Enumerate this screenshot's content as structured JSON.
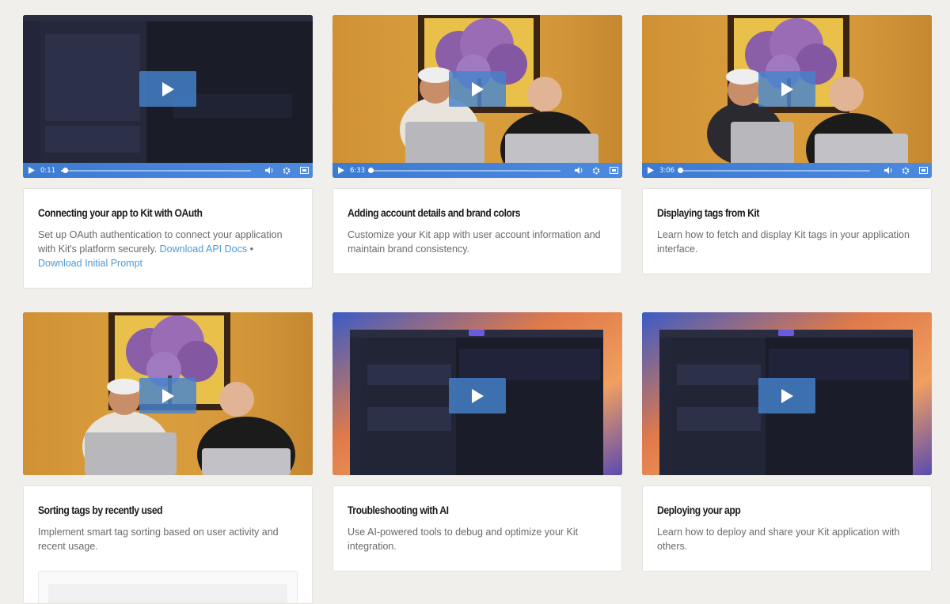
{
  "videos": [
    {
      "title": "Connecting your app to Kit with OAuth",
      "desc": "Set up OAuth authentication to connect your application with Kit's platform securely.",
      "link1": "Download API Docs",
      "sep": "•",
      "link2": "Download Initial Prompt",
      "time": "0:11",
      "progress": 0.02
    },
    {
      "title": "Adding account details and brand colors",
      "desc": "Customize your Kit app with user account information and maintain brand consistency.",
      "time": "6:33",
      "progress": 0.0
    },
    {
      "title": "Displaying tags from Kit",
      "desc": "Learn how to fetch and display Kit tags in your application interface.",
      "time": "3:06",
      "progress": 0.0
    },
    {
      "title": "Sorting tags by recently used",
      "desc": "Implement smart tag sorting based on user activity and recent usage."
    },
    {
      "title": "Troubleshooting with AI",
      "desc": "Use AI-powered tools to debug and optimize your Kit integration."
    },
    {
      "title": "Deploying your app",
      "desc": "Learn how to deploy and share your Kit application with others."
    }
  ],
  "icons": {
    "play": "play-icon",
    "volume": "volume-icon",
    "settings": "gear-icon",
    "fullscreen": "fullscreen-icon"
  },
  "colors": {
    "control_bar": "#3b7bd1",
    "play_overlay": "#4682cd",
    "link": "#4a9ad6"
  }
}
